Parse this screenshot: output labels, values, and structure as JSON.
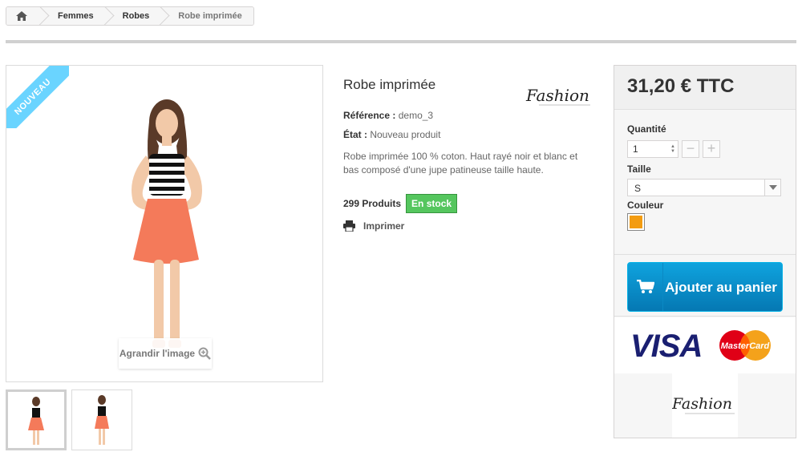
{
  "breadcrumb": {
    "items": [
      "Femmes",
      "Robes"
    ],
    "current": "Robe imprimée"
  },
  "product": {
    "ribbon": "NOUVEAU",
    "zoom_label": "Agrandir l'image",
    "title": "Robe imprimée",
    "brand_logo_text": "Fashion",
    "reference_label": "Référence :",
    "reference_value": "demo_3",
    "condition_label": "État :",
    "condition_value": "Nouveau produit",
    "description": "Robe imprimée 100 % coton. Haut rayé noir et blanc et bas composé d'une jupe patineuse taille haute.",
    "quantity_available": "299 Produits",
    "stock_badge": "En stock",
    "print_label": "Imprimer"
  },
  "buy_box": {
    "price": "31,20 € TTC",
    "quantity_label": "Quantité",
    "quantity_value": "1",
    "size_label": "Taille",
    "size_value": "S",
    "color_label": "Couleur",
    "color_swatch": "#f39c11",
    "add_to_cart": "Ajouter au panier",
    "visa_text": "VISA",
    "mastercard_text": "MasterCard",
    "logo_text": "Fashion"
  },
  "colors": {
    "accent": "#0a8fd0",
    "stock": "#55c65e",
    "ribbon": "#6ad4ff"
  }
}
